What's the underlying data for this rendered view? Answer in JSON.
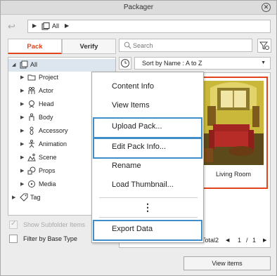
{
  "window": {
    "title": "Packager"
  },
  "breadcrumb": {
    "label": "All"
  },
  "tabs": [
    {
      "label": "Pack",
      "active": true
    },
    {
      "label": "Verify",
      "active": false
    }
  ],
  "tree": {
    "items": [
      {
        "label": "All",
        "icon": "folder-outline-icon",
        "expanded": true,
        "selected": true
      },
      {
        "label": "Project",
        "icon": "folder-icon"
      },
      {
        "label": "Actor",
        "icon": "actor-icon"
      },
      {
        "label": "Head",
        "icon": "head-icon"
      },
      {
        "label": "Body",
        "icon": "body-icon"
      },
      {
        "label": "Accessory",
        "icon": "accessory-icon"
      },
      {
        "label": "Animation",
        "icon": "animation-icon"
      },
      {
        "label": "Scene",
        "icon": "scene-icon"
      },
      {
        "label": "Props",
        "icon": "props-icon"
      },
      {
        "label": "Media",
        "icon": "media-icon"
      },
      {
        "label": "Tag",
        "icon": "tag-icon"
      }
    ]
  },
  "options": {
    "show_subfolder_items": {
      "label": "Show Subfolder Items",
      "checked": true,
      "disabled": true
    },
    "filter_by_base_type": {
      "label": "Filter by Base Type",
      "checked": false,
      "disabled": false
    }
  },
  "search": {
    "placeholder": "Search",
    "value": ""
  },
  "sort": {
    "label": "Sort by Name : A to Z"
  },
  "items": [
    {
      "title": "Living Room",
      "selected": true
    }
  ],
  "pager": {
    "total_label": "Total2",
    "current_page": "1",
    "separator": "/",
    "total_pages": "1"
  },
  "footer": {
    "view_items_label": "View items"
  },
  "context_menu": {
    "items": [
      {
        "label": "Content Info",
        "highlighted": false
      },
      {
        "label": "View Items",
        "highlighted": false
      },
      {
        "label": "Upload Pack...",
        "highlighted": true
      },
      {
        "label": "Edit Pack Info...",
        "highlighted": true
      },
      {
        "label": "Rename",
        "highlighted": false
      },
      {
        "label": "Load Thumbnail...",
        "highlighted": false
      },
      {
        "label": "Export Data",
        "highlighted": true
      }
    ],
    "more_label": "⋮"
  },
  "colors": {
    "accent": "#e0451e",
    "highlight_border": "#3f8ec9",
    "selection": "#dde6ef"
  }
}
